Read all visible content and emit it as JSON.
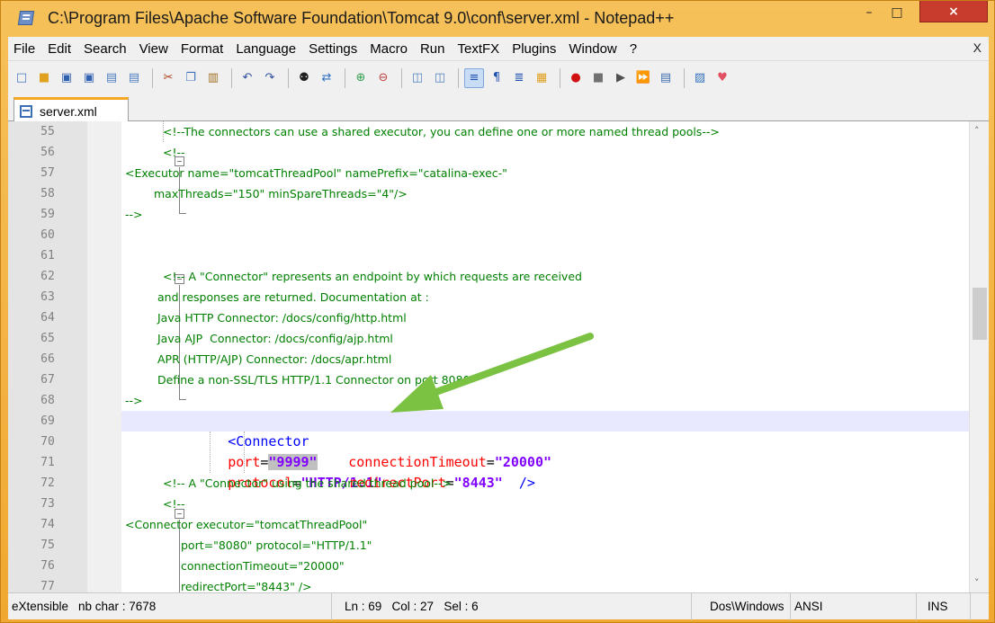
{
  "window": {
    "title": "C:\\Program Files\\Apache Software Foundation\\Tomcat 9.0\\conf\\server.xml - Notepad++",
    "minimize_icon": "minimize-icon",
    "maximize_icon": "maximize-icon",
    "close_glyph": "×"
  },
  "menu": {
    "items": [
      "File",
      "Edit",
      "Search",
      "View",
      "Format",
      "Language",
      "Settings",
      "Macro",
      "Run",
      "TextFX",
      "Plugins",
      "Window",
      "?"
    ],
    "close_label": "X"
  },
  "toolbar": {
    "icons": [
      "new-file-icon",
      "open-file-icon",
      "save-icon",
      "save-all-icon",
      "close-icon",
      "close-all-icon",
      "cut-icon",
      "copy-icon",
      "paste-icon",
      "undo-icon",
      "redo-icon",
      "find-icon",
      "replace-icon",
      "zoom-in-icon",
      "zoom-out-icon",
      "sync-vertical-icon",
      "sync-horizontal-icon",
      "word-wrap-icon",
      "show-all-chars-icon",
      "indent-guide-icon",
      "doc-map-icon",
      "record-macro-icon",
      "stop-record-icon",
      "playback-macro-icon",
      "run-macro-multiple-icon",
      "save-macro-icon",
      "tidy-icon",
      "heart-icon"
    ]
  },
  "tabs": [
    {
      "label": "server.xml",
      "icon": "file-icon",
      "active": true
    }
  ],
  "editor": {
    "lines": [
      {
        "n": "55",
        "text": "<!--The connectors can use a shared executor, you can define one or more named thread pools-->",
        "indent": 46
      },
      {
        "n": "56",
        "text": "<!--",
        "indent": 46
      },
      {
        "n": "57",
        "text": "<Executor name=\"tomcatThreadPool\" namePrefix=\"catalina-exec-\"",
        "indent": 4
      },
      {
        "n": "58",
        "text": "maxThreads=\"150\" minSpareThreads=\"4\"/>",
        "indent": 36
      },
      {
        "n": "59",
        "text": "-->",
        "indent": 4
      },
      {
        "n": "60",
        "text": "",
        "indent": 4
      },
      {
        "n": "61",
        "text": "",
        "indent": 4
      },
      {
        "n": "62",
        "text": "<!-- A \"Connector\" represents an endpoint by which requests are received",
        "indent": 46
      },
      {
        "n": "63",
        "text": "and responses are returned. Documentation at :",
        "indent": 40
      },
      {
        "n": "64",
        "text": "Java HTTP Connector: /docs/config/http.html",
        "indent": 40
      },
      {
        "n": "65",
        "text": "Java AJP  Connector: /docs/config/ajp.html",
        "indent": 40
      },
      {
        "n": "66",
        "text": "APR (HTTP/AJP) Connector: /docs/apr.html",
        "indent": 40
      },
      {
        "n": "67",
        "text": "Define a non-SSL/TLS HTTP/1.1 Connector on port 8080",
        "indent": 40
      },
      {
        "n": "68",
        "text": "-->",
        "indent": 4
      },
      {
        "n": "69",
        "text": "",
        "indent": 46
      },
      {
        "n": "70",
        "text": "",
        "indent": 46
      },
      {
        "n": "71",
        "text": "",
        "indent": 46
      },
      {
        "n": "72",
        "text": "<!-- A \"Connector\" using the shared thread pool-->",
        "indent": 46
      },
      {
        "n": "73",
        "text": "<!--",
        "indent": 46
      },
      {
        "n": "74",
        "text": "<Connector executor=\"tomcatThreadPool\"",
        "indent": 4
      },
      {
        "n": "75",
        "text": "port=\"8080\" protocol=\"HTTP/1.1\"",
        "indent": 66
      },
      {
        "n": "76",
        "text": "connectionTimeout=\"20000\"",
        "indent": 66
      },
      {
        "n": "77",
        "text": "redirectPort=\"8443\" />",
        "indent": 66
      }
    ],
    "connector": {
      "tag": "<Connector",
      "port_attr": "port",
      "port_value": "\"9999\"",
      "protocol_attr": "protocol",
      "protocol_value": "\"HTTP/1.1\"",
      "timeout_attr": "connectionTimeout",
      "timeout_value": "\"20000\"",
      "redirect_attr": "redirectPort",
      "redirect_value": "\"8443\"",
      "close": "/>",
      "eq": "="
    },
    "current_line": 69
  },
  "status": {
    "lang": "eXtensible",
    "chars": "nb char : 7678",
    "position": "Ln : 69   Col : 27   Sel : 6",
    "eol": "Dos\\Windows",
    "encoding": "ANSI",
    "mode": "INS"
  },
  "colors": {
    "frame": "#f5a623",
    "comment": "#008000",
    "tag": "#0000ff",
    "attribute": "#ff0000",
    "value": "#8000ff",
    "current_line": "#e8e8ff",
    "arrow": "#7cc242"
  }
}
